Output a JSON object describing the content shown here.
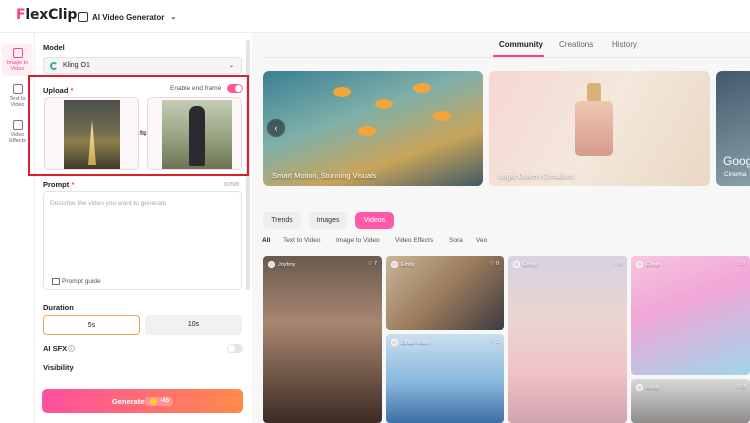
{
  "app": {
    "logo_text": "FlexClip",
    "tool_name": "AI Video Generator",
    "brand_color": "#ff3f7e"
  },
  "left_nav": [
    {
      "label": "Image to Video",
      "active": true
    },
    {
      "label": "Text to Video",
      "active": false
    },
    {
      "label": "Video Effects",
      "active": false
    }
  ],
  "panel": {
    "model_label": "Model",
    "model_value": "Kling O1",
    "upload_label": "Upload",
    "required_mark": "*",
    "end_frame_label": "Enable end frame",
    "end_frame_on": true,
    "prompt_label": "Prompt",
    "prompt_count": "0/2500",
    "prompt_placeholder": "Describe the video you want to generate",
    "prompt_guide": "Prompt guide",
    "duration_label": "Duration",
    "durations": [
      "5s",
      "10s"
    ],
    "selected_duration": "5s",
    "sfx_label": "AI SFX",
    "sfx_info": "i",
    "sfx_on": false,
    "visibility_label": "Visibility",
    "generate_label": "Generate",
    "generate_cost": "-45"
  },
  "tabs": [
    {
      "label": "Community",
      "active": true
    },
    {
      "label": "Creations",
      "active": false
    },
    {
      "label": "History",
      "active": false
    }
  ],
  "banners": [
    {
      "caption": "Smart Motion, Stunning Visuals"
    },
    {
      "caption": "Logic-Driven Creations"
    },
    {
      "caption_big": "Goog",
      "caption_small": "Cinema"
    }
  ],
  "content_types": [
    {
      "label": "Trends",
      "active": false
    },
    {
      "label": "Images",
      "active": false
    },
    {
      "label": "Videos",
      "active": true
    }
  ],
  "filters": [
    {
      "label": "All",
      "active": true
    },
    {
      "label": "Text to Video",
      "active": false
    },
    {
      "label": "Image to Video",
      "active": false
    },
    {
      "label": "Video Effects",
      "active": false
    },
    {
      "label": "Sora",
      "active": false
    },
    {
      "label": "Veo",
      "active": false
    }
  ],
  "cards": [
    {
      "author": "Joyboy",
      "likes": "7"
    },
    {
      "author": "Emily",
      "likes": "0"
    },
    {
      "author": "Ethan Miller",
      "likes": "1"
    },
    {
      "author": "Emily",
      "likes": "0"
    },
    {
      "author": "Elean",
      "likes": "0"
    },
    {
      "author": "Emily",
      "likes": "0"
    }
  ],
  "icons": {
    "heart": "♡",
    "chevron_down": "⌄",
    "swap": "⇋",
    "arrow_left": "‹"
  }
}
